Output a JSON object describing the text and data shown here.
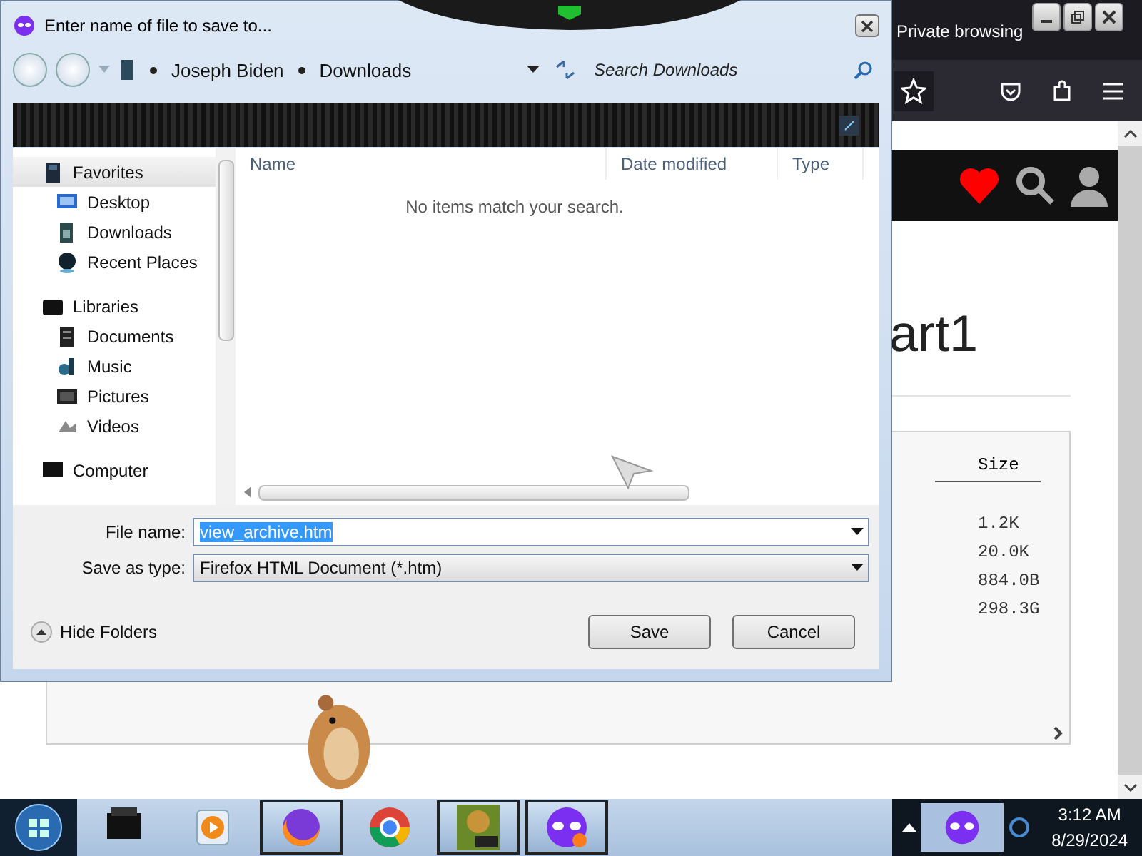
{
  "browser": {
    "title": "Private browsing",
    "heading": "art1",
    "table": {
      "columns": [
        "Size"
      ],
      "rows": [
        "1.2K",
        "20.0K",
        "884.0B",
        "298.3G"
      ]
    }
  },
  "dialog": {
    "title": "Enter name of file to save to...",
    "breadcrumb": [
      "Joseph Biden",
      "Downloads"
    ],
    "search": {
      "placeholder": "Search Downloads"
    },
    "nav": [
      {
        "label": "Favorites",
        "selected": true,
        "children": [
          {
            "label": "Desktop",
            "selected": false
          },
          {
            "label": "Downloads",
            "selected": false
          },
          {
            "label": "Recent Places",
            "selected": false
          }
        ]
      },
      {
        "label": "Libraries",
        "selected": false,
        "children": [
          {
            "label": "Documents",
            "selected": false
          },
          {
            "label": "Music",
            "selected": false
          },
          {
            "label": "Pictures",
            "selected": false
          },
          {
            "label": "Videos",
            "selected": false
          }
        ]
      },
      {
        "label": "Computer",
        "selected": false
      }
    ],
    "columns": [
      "Name",
      "Date modified",
      "Type"
    ],
    "empty_message": "No items match your search.",
    "file_name_label": "File name:",
    "file_name": {
      "value": "view_archive.htm",
      "selected": true
    },
    "type_label": "Save as type:",
    "save_as_type": "Firefox HTML Document (*.htm)",
    "hide_folders": "Hide Folders",
    "buttons": [
      "Save",
      "Cancel"
    ]
  },
  "taskbar": {
    "apps": [
      {
        "open": false
      },
      {
        "open": false
      },
      {
        "open": true
      },
      {
        "open": false
      },
      {
        "open": true
      },
      {
        "open": true
      }
    ],
    "time": "3:12 AM",
    "date": "8/29/2024"
  }
}
